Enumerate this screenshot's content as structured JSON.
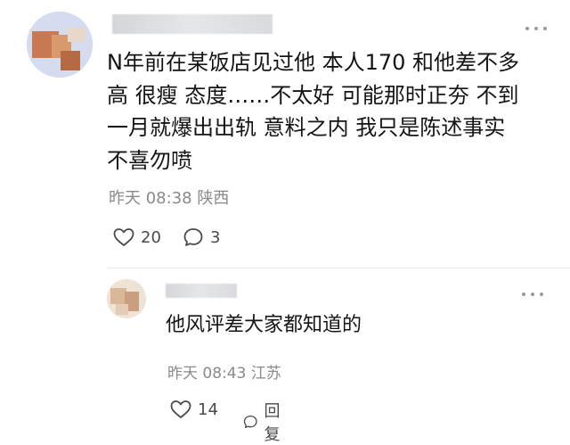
{
  "main_comment": {
    "lines": [
      "N年前在某饭店见过他 本人170 和他差不多",
      "高 很瘦 态度……不太好 可能那时正夯 不到",
      "一月就爆出出轨 意料之内 我只是陈述事实",
      "不喜勿喷"
    ],
    "time": "昨天 08:38",
    "location": "陕西",
    "likes": "20",
    "replies": "3"
  },
  "reply_comment": {
    "text": "他风评差大家都知道的",
    "time": "昨天 08:43",
    "location": "江苏",
    "likes": "14",
    "reply_label": "回复"
  },
  "icons": {
    "like": "heart-outline-icon",
    "comment": "speech-bubble-icon",
    "more": "more-dots-icon"
  },
  "colors": {
    "text": "#141414",
    "meta": "#8a8a8a",
    "icon": "#4a4a4a"
  }
}
